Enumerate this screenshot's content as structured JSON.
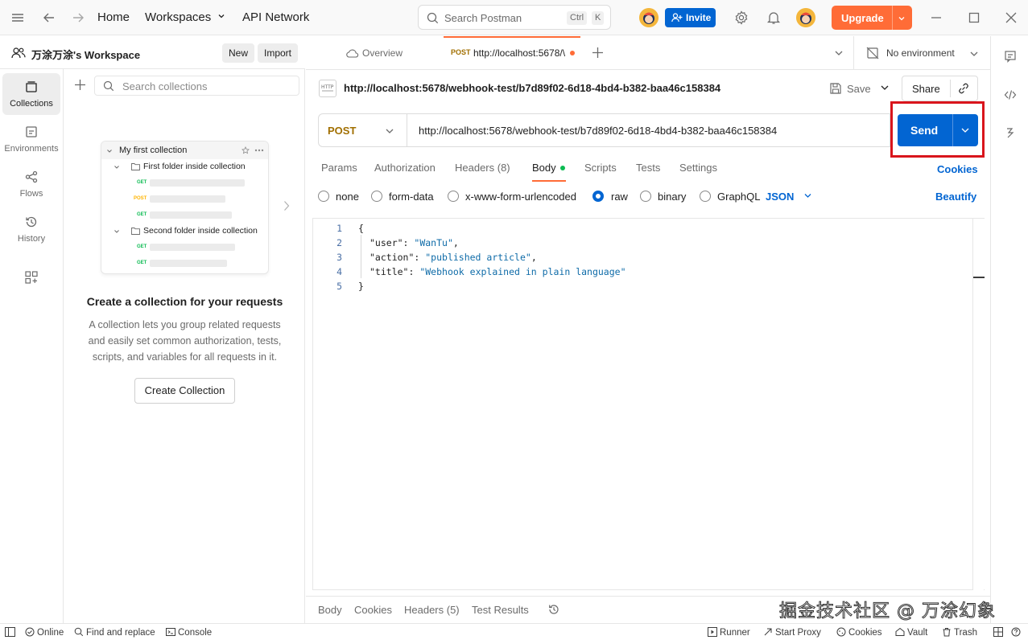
{
  "titlebar": {
    "home": "Home",
    "workspaces": "Workspaces",
    "api_network": "API Network",
    "search_placeholder": "Search Postman",
    "kbd_ctrl": "Ctrl",
    "kbd_k": "K",
    "invite": "Invite",
    "upgrade": "Upgrade"
  },
  "workspace": {
    "name": "万涂万涂's Workspace",
    "new_btn": "New",
    "import_btn": "Import"
  },
  "rail": [
    {
      "label": "Collections",
      "icon": "collections-icon"
    },
    {
      "label": "Environments",
      "icon": "environments-icon"
    },
    {
      "label": "Flows",
      "icon": "flows-icon"
    },
    {
      "label": "History",
      "icon": "history-icon"
    }
  ],
  "collections": {
    "search_placeholder": "Search collections",
    "illustration": {
      "collection": "My first collection",
      "folder1": "First folder inside collection",
      "folder2": "Second folder inside collection",
      "methods": [
        "GET",
        "POST",
        "GET",
        "GET",
        "GET"
      ]
    },
    "empty_title": "Create a collection for your requests",
    "empty_desc": "A collection lets you group related requests and easily set common authorization, tests, scripts, and variables for all requests in it.",
    "create_btn": "Create Collection"
  },
  "tabs": {
    "overview": "Overview",
    "active_method": "POST",
    "active_title": "http://localhost:5678/\\",
    "environment": "No environment"
  },
  "request": {
    "header_url": "http://localhost:5678/webhook-test/b7d89f02-6d18-4bd4-b382-baa46c158384",
    "save": "Save",
    "share": "Share",
    "method": "POST",
    "url": "http://localhost:5678/webhook-test/b7d89f02-6d18-4bd4-b382-baa46c158384",
    "send": "Send",
    "tabs": [
      "Params",
      "Authorization",
      "Headers (8)",
      "Body",
      "Scripts",
      "Tests",
      "Settings"
    ],
    "cookies": "Cookies",
    "body_types": [
      "none",
      "form-data",
      "x-www-form-urlencoded",
      "raw",
      "binary",
      "GraphQL"
    ],
    "format": "JSON",
    "beautify": "Beautify",
    "code_lines": [
      {
        "n": "1",
        "text": "{"
      },
      {
        "n": "2",
        "key": "\"user\"",
        "val": "\"WanTu\"",
        "comma": ","
      },
      {
        "n": "3",
        "key": "\"action\"",
        "val": "\"published article\"",
        "comma": ","
      },
      {
        "n": "4",
        "key": "\"title\"",
        "val": "\"Webhook explained in plain language\"",
        "comma": ""
      },
      {
        "n": "5",
        "text": "}"
      }
    ]
  },
  "response": {
    "tabs": [
      "Body",
      "Cookies",
      "Headers (5)",
      "Test Results"
    ]
  },
  "status": {
    "online": "Online",
    "find_replace": "Find and replace",
    "console": "Console",
    "runner": "Runner",
    "start_proxy": "Start Proxy",
    "cookies": "Cookies",
    "vault": "Vault",
    "trash": "Trash"
  },
  "watermark": "掘金技术社区 @ 万涂幻象",
  "colors": {
    "accent": "#ff6c37",
    "primary": "#0265d2",
    "post_method": "#a16f00",
    "highlight_box": "#d9151c"
  }
}
